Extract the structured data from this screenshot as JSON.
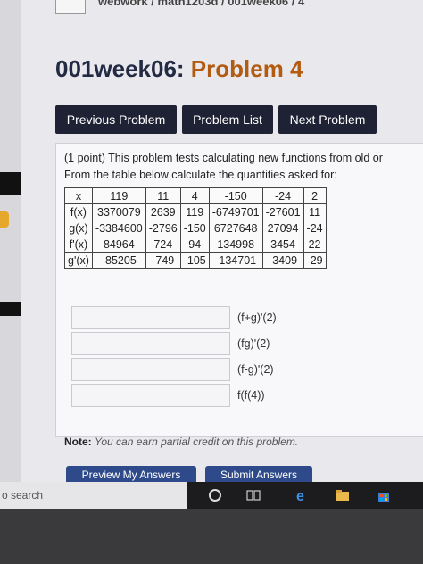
{
  "breadcrumb": {
    "text": "webwork / math1203d / 001week06 / 4"
  },
  "header": {
    "course": "001week06:",
    "problem": "Problem 4"
  },
  "nav": {
    "previous": "Previous Problem",
    "list": "Problem List",
    "next": "Next Problem"
  },
  "problem": {
    "line1": "(1 point) This problem tests calculating new functions from old or",
    "line2": "From the table below calculate the quantities asked for:"
  },
  "table": {
    "rows": [
      [
        "x",
        "119",
        "11",
        "4",
        "-150",
        "-24",
        "2"
      ],
      [
        "f(x)",
        "3370079",
        "2639",
        "119",
        "-6749701",
        "-27601",
        "11"
      ],
      [
        "g(x)",
        "-3384600",
        "-2796",
        "-150",
        "6727648",
        "27094",
        "-24"
      ],
      [
        "f'(x)",
        "84964",
        "724",
        "94",
        "134998",
        "3454",
        "22"
      ],
      [
        "g'(x)",
        "-85205",
        "-749",
        "-105",
        "-134701",
        "-3409",
        "-29"
      ]
    ]
  },
  "answers": [
    {
      "label": "(f+g)'(2)",
      "value": ""
    },
    {
      "label": "(fg)'(2)",
      "value": ""
    },
    {
      "label": "(f-g)'(2)",
      "value": ""
    },
    {
      "label": "f(f(4))",
      "value": ""
    }
  ],
  "note": {
    "label": "Note:",
    "text": "You can earn partial credit on this problem."
  },
  "buttons": {
    "preview": "Preview My Answers",
    "submit": "Submit Answers"
  },
  "taskbar": {
    "search": "o search"
  },
  "colors": {
    "nav_bg": "#1f2235",
    "title_accent": "#b25b12",
    "button_blue": "#2e4a8a"
  }
}
